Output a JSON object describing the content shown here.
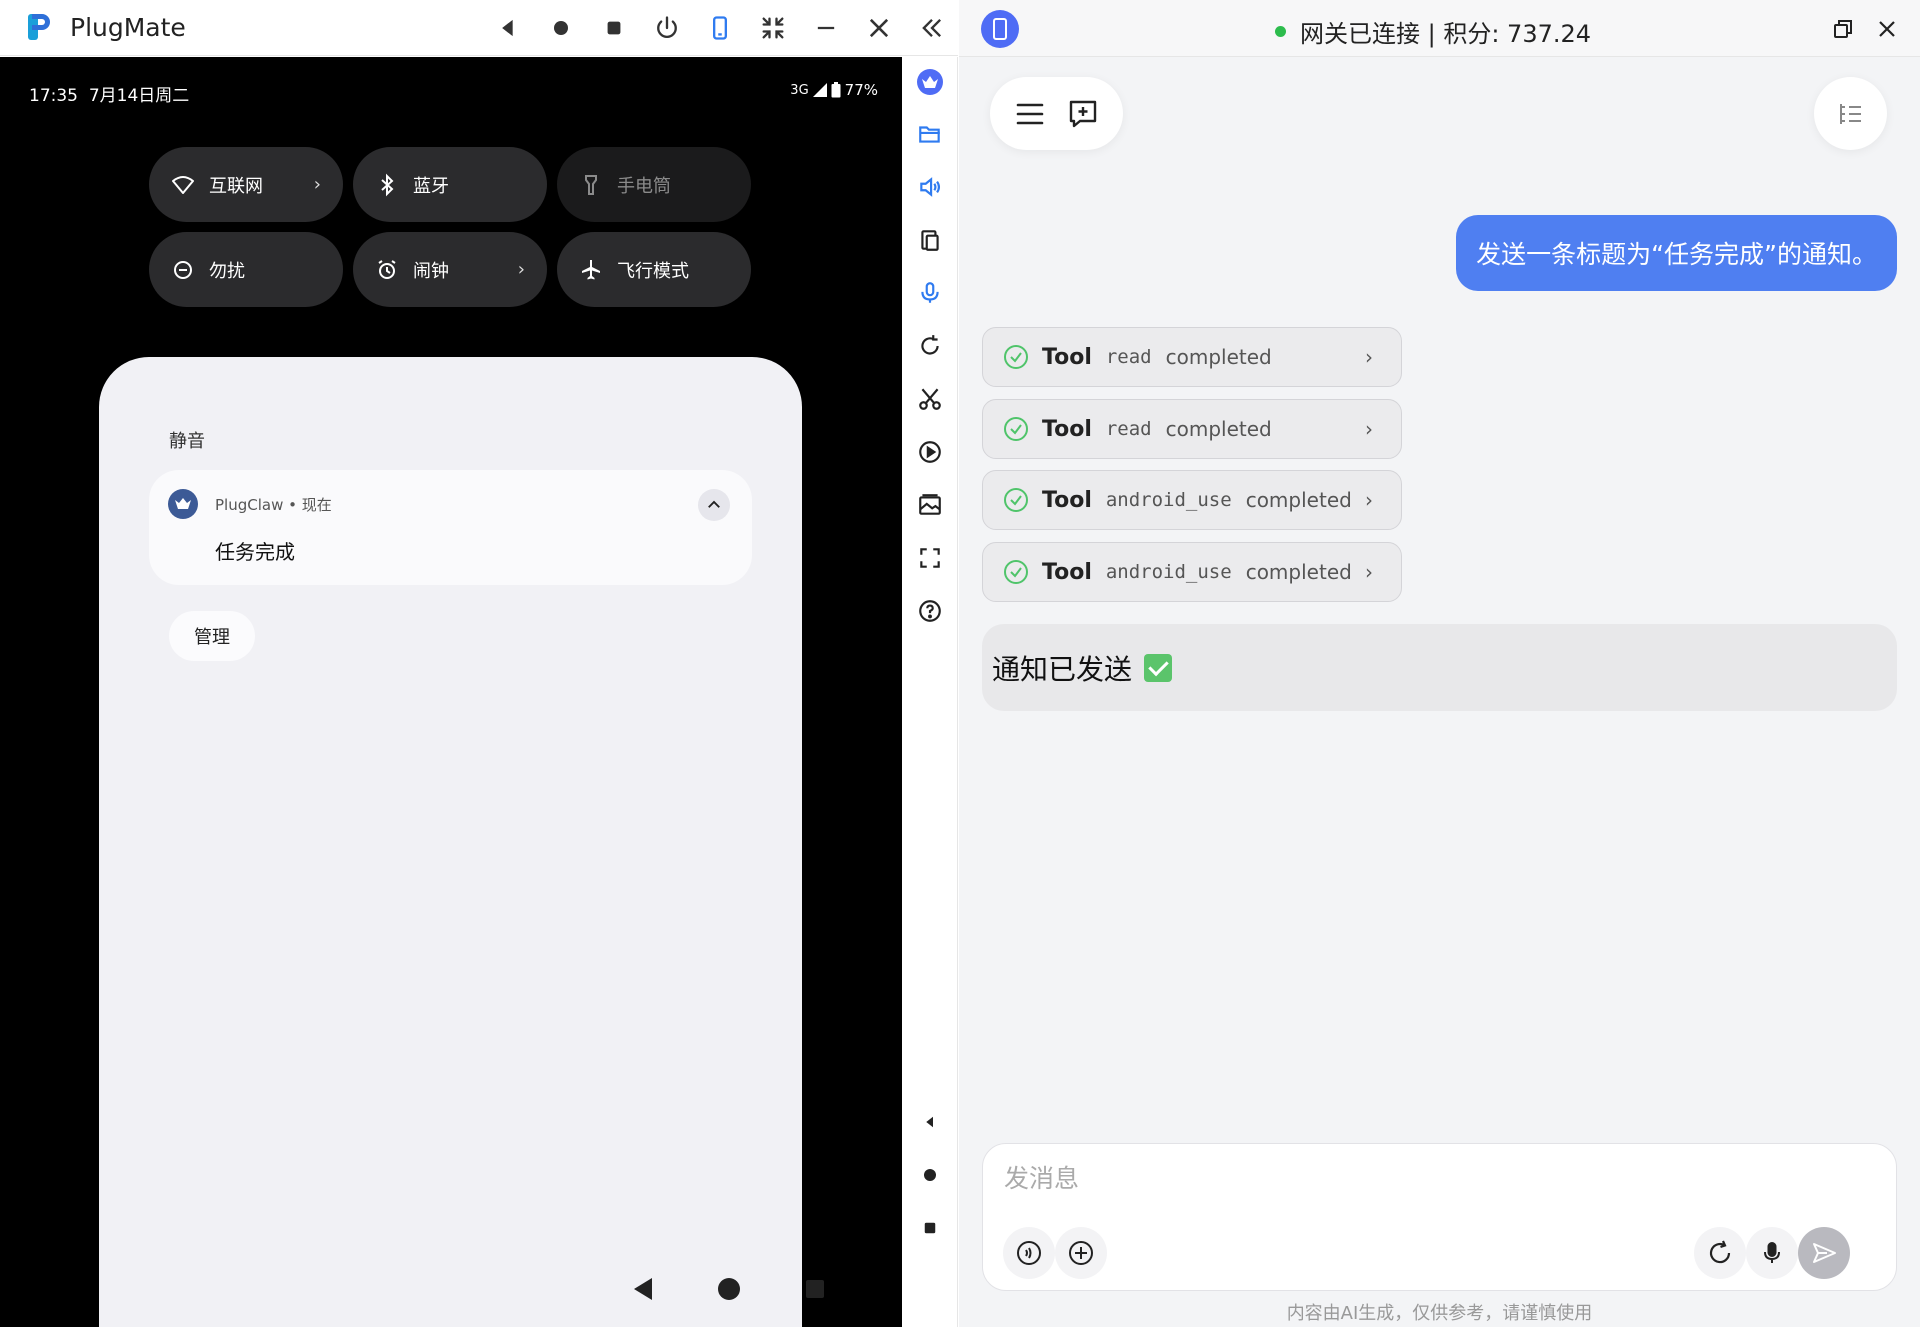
{
  "app": {
    "title": "PlugMate"
  },
  "status_bar": {
    "time": "17:35",
    "date": "7月14日周二",
    "network": "3G",
    "battery": "77%"
  },
  "quick_tiles": [
    {
      "label": "互联网",
      "icon": "wifi-icon",
      "chevron": "›"
    },
    {
      "label": "蓝牙",
      "icon": "bluetooth-icon",
      "chevron": ""
    },
    {
      "label": "手电筒",
      "icon": "flashlight-icon",
      "chevron": ""
    },
    {
      "label": "勿扰",
      "icon": "dnd-icon",
      "chevron": ""
    },
    {
      "label": "闹钟",
      "icon": "alarm-icon",
      "chevron": "›"
    },
    {
      "label": "飞行模式",
      "icon": "airplane-icon",
      "chevron": ""
    }
  ],
  "notification_shade": {
    "section_label": "静音",
    "notification": {
      "app": "PlugClaw • 现在",
      "title": "任务完成"
    },
    "manage_label": "管理"
  },
  "chat_header": {
    "connection": "网关已连接 | 积分: 737.24",
    "accent": "#4f6cf5"
  },
  "messages": {
    "user": "发送一条标题为“任务完成”的通知。",
    "tools": [
      {
        "word": "Tool",
        "name": "read",
        "status": "completed"
      },
      {
        "word": "Tool",
        "name": "read",
        "status": "completed"
      },
      {
        "word": "Tool",
        "name": "android_use",
        "status": "completed"
      },
      {
        "word": "Tool",
        "name": "android_use",
        "status": "completed"
      }
    ],
    "assistant": "通知已发送"
  },
  "composer": {
    "placeholder": "发消息",
    "disclaimer": "内容由AI生成，仅供参考，请谨慎使用"
  },
  "colors": {
    "user_bubble": "#4f7ff1",
    "connected_dot": "#2dbc4d",
    "tool_accent": "#2f7bf0"
  }
}
